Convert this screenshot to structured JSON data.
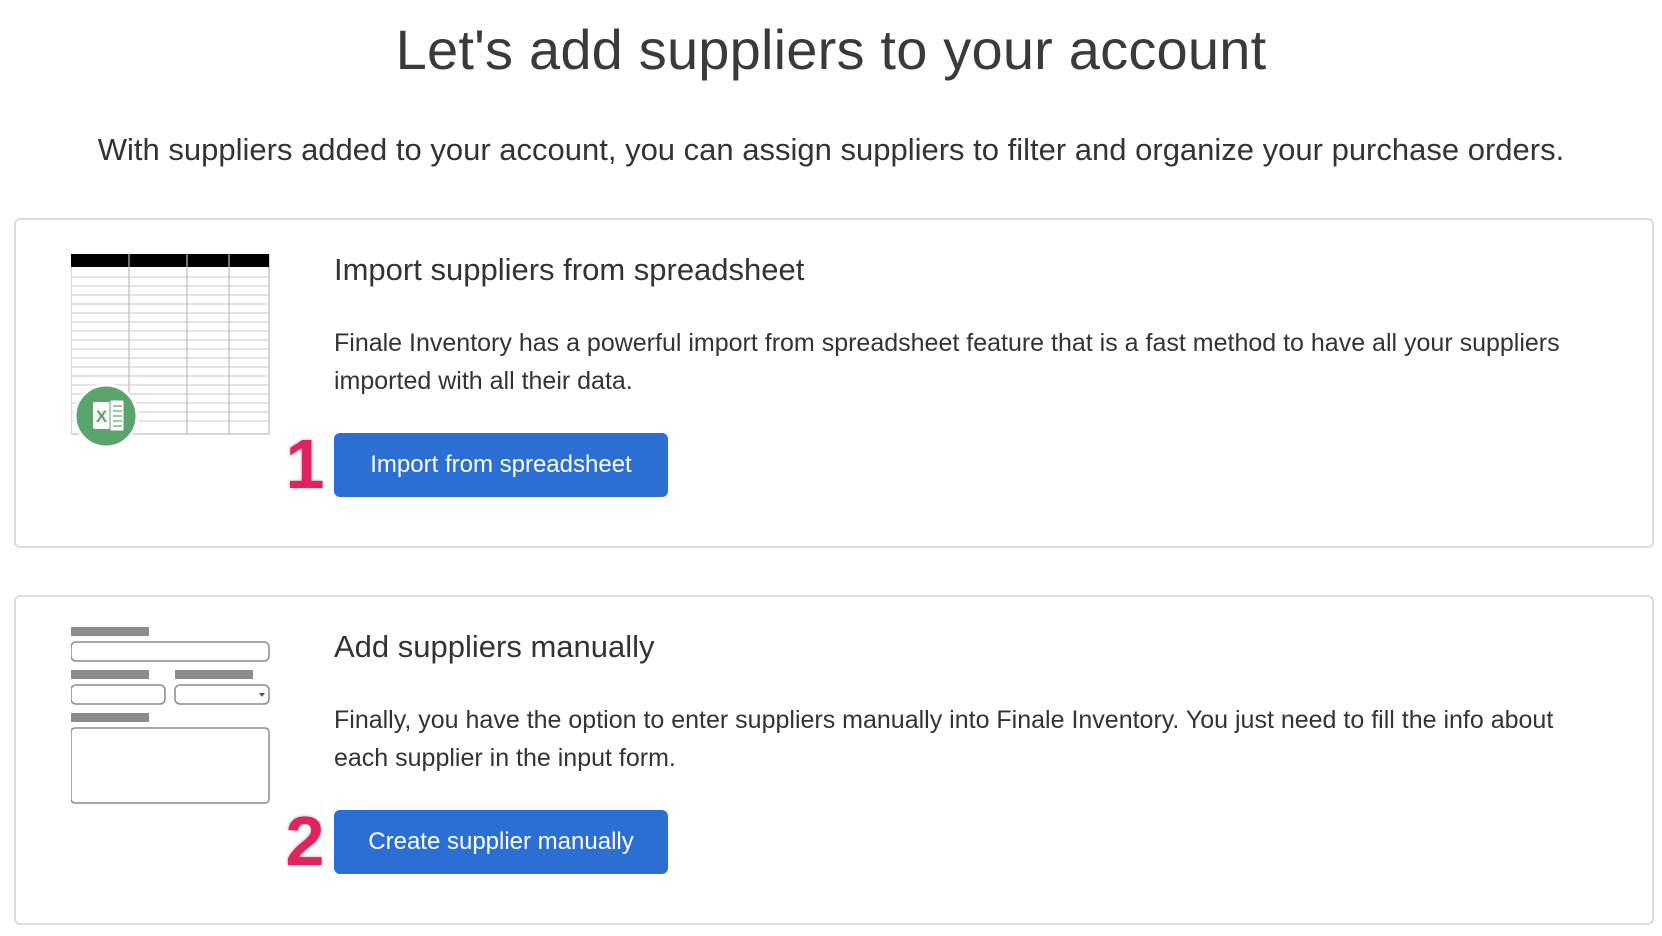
{
  "header": {
    "title": "Let's add suppliers to your account",
    "subtitle": "With suppliers added to your account, you can assign suppliers to filter and organize your purchase orders."
  },
  "import_card": {
    "heading": "Import suppliers from spreadsheet",
    "description": "Finale Inventory has a powerful import from spreadsheet feature that is a fast method to have all your suppliers imported with all their data.",
    "button_label": "Import from spreadsheet",
    "step_number": "1",
    "illustration_icon": "excel-spreadsheet-icon",
    "excel_badge_letter": "X"
  },
  "manual_card": {
    "heading": "Add suppliers manually",
    "description": "Finally, you have the option to enter suppliers manually into Finale Inventory. You just need to fill the info about each supplier in the input form.",
    "button_label": "Create supplier manually",
    "step_number": "2",
    "illustration_icon": "input-form-icon"
  },
  "colors": {
    "button_blue": "#2b6fd5",
    "step_badge_pink": "#e0245e",
    "card_border": "#dcdcdc",
    "excel_green": "#5aa56b"
  }
}
